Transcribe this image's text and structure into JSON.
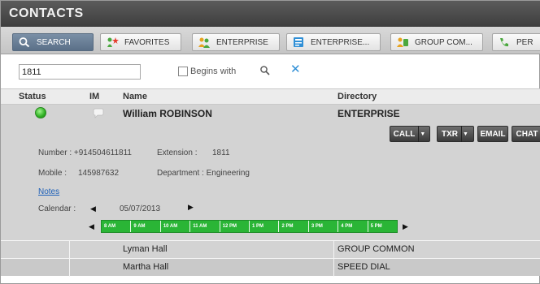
{
  "title": "CONTACTS",
  "tabs": [
    {
      "label": "SEARCH",
      "icon": "search-icon",
      "active": true
    },
    {
      "label": "FAVORITES",
      "icon": "favorites-star-icon",
      "active": false
    },
    {
      "label": "ENTERPRISE",
      "icon": "people-icon",
      "active": false
    },
    {
      "label": "ENTERPRISE...",
      "icon": "directory-book-icon",
      "active": false
    },
    {
      "label": "GROUP COM...",
      "icon": "group-common-icon",
      "active": false
    },
    {
      "label": "PER",
      "icon": "personal-phone-icon",
      "active": false
    }
  ],
  "search": {
    "value": "1811",
    "begins_with_label": "Begins with",
    "begins_with_checked": false
  },
  "table": {
    "headers": {
      "status": "Status",
      "im": "IM",
      "name": "Name",
      "directory": "Directory"
    }
  },
  "selected_contact": {
    "name": "William ROBINSON",
    "directory": "ENTERPRISE",
    "status_color": "#2fb023",
    "actions": {
      "call": "CALL",
      "txr": "TXR",
      "email": "EMAIL",
      "chat": "CHAT"
    },
    "number_text": "Number : +914504611811",
    "extension_label": "Extension :",
    "extension_value": "1811",
    "mobile_label": "Mobile :",
    "mobile_value": "145987632",
    "department_text": "Department : Engineering",
    "notes_label": "Notes",
    "calendar_label": "Calendar :",
    "calendar_date": "05/07/2013",
    "time_slots": [
      "8 AM",
      "9 AM",
      "10 AM",
      "11 AM",
      "12 PM",
      "1 PM",
      "2 PM",
      "3 PM",
      "4 PM",
      "5 PM"
    ]
  },
  "rows": [
    {
      "name": "Lyman Hall",
      "directory": "GROUP COMMON"
    },
    {
      "name": "Martha Hall",
      "directory": "SPEED DIAL"
    }
  ],
  "colors": {
    "row_even": "#d3d3d3",
    "row_odd": "#c9c9c9",
    "timeline_green": "#2ab536",
    "active_tab": "#5b7088"
  }
}
